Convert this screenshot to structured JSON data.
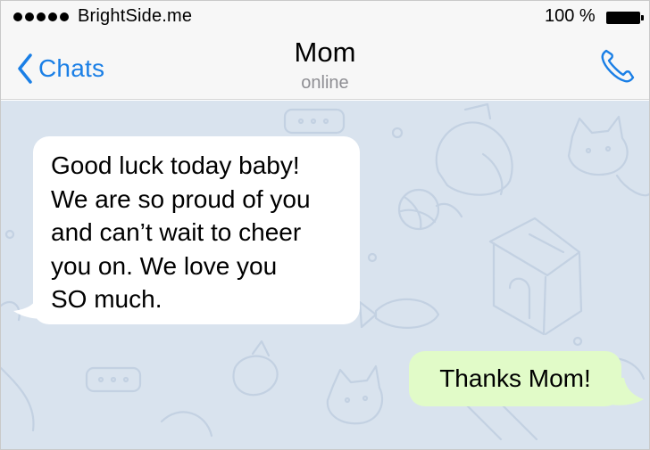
{
  "status_bar": {
    "carrier": "BrightSide.me",
    "battery_percent": "100 %",
    "signal_bars": 5,
    "battery_level": 1.0
  },
  "nav": {
    "back_label": "Chats",
    "title": "Mom",
    "subtitle": "online",
    "back_icon": "chevron-left-icon",
    "call_icon": "phone-icon",
    "accent_color": "#1a7fe6"
  },
  "messages": [
    {
      "direction": "incoming",
      "text": "Good luck today baby! We are so proud of you and can’t wait to cheer you on. We love you SO much.",
      "lines": [
        "Good luck today baby!",
        "We are so proud of you",
        "and can’t wait to cheer",
        "you on. We love you",
        "SO much."
      ],
      "bubble_color": "#ffffff"
    },
    {
      "direction": "outgoing",
      "text": "Thanks Mom!",
      "bubble_color": "#e1fbc8"
    }
  ],
  "chat_background_color": "#d9e3ee"
}
